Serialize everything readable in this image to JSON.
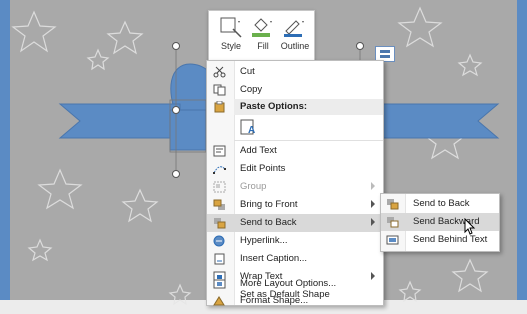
{
  "mini_toolbar": {
    "style_label": "Style",
    "fill_label": "Fill",
    "outline_label": "Outline"
  },
  "context_menu": {
    "items": [
      {
        "label": "Cut",
        "name": "cut",
        "icon": "scissors-icon",
        "submenu": false,
        "disabled": false
      },
      {
        "label": "Copy",
        "name": "copy",
        "icon": "copy-icon",
        "submenu": false,
        "disabled": false
      },
      {
        "label": "Paste Options:",
        "name": "paste-options",
        "icon": "clipboard-icon",
        "submenu": false,
        "disabled": false
      },
      {
        "label": "Add Text",
        "name": "add-text",
        "icon": "text-box-icon",
        "submenu": false,
        "disabled": false
      },
      {
        "label": "Edit Points",
        "name": "edit-points",
        "icon": "edit-points-icon",
        "submenu": false,
        "disabled": false
      },
      {
        "label": "Group",
        "name": "group",
        "icon": "group-icon",
        "submenu": true,
        "disabled": true
      },
      {
        "label": "Bring to Front",
        "name": "bring-to-front",
        "icon": "bring-to-front-icon",
        "submenu": true,
        "disabled": false
      },
      {
        "label": "Send to Back",
        "name": "send-to-back",
        "icon": "send-to-back-icon",
        "submenu": true,
        "disabled": false
      },
      {
        "label": "Hyperlink...",
        "name": "hyperlink",
        "icon": "hyperlink-icon",
        "submenu": false,
        "disabled": false
      },
      {
        "label": "Insert Caption...",
        "name": "insert-caption",
        "icon": "caption-icon",
        "submenu": false,
        "disabled": false
      },
      {
        "label": "Wrap Text",
        "name": "wrap-text",
        "icon": "wrap-text-icon",
        "submenu": true,
        "disabled": false
      },
      {
        "label": "Set as Default Shape",
        "name": "set-default-shape",
        "icon": "",
        "submenu": false,
        "disabled": false
      },
      {
        "label": "More Layout Options...",
        "name": "more-layout-options",
        "icon": "layout-options-icon",
        "submenu": false,
        "disabled": false
      },
      {
        "label": "Format Shape...",
        "name": "format-shape",
        "icon": "format-shape-icon",
        "submenu": false,
        "disabled": false
      }
    ]
  },
  "submenu": {
    "items": [
      {
        "label": "Send to Back",
        "name": "send-to-back"
      },
      {
        "label": "Send Backward",
        "name": "send-backward"
      },
      {
        "label": "Send Behind Text",
        "name": "send-behind-text"
      }
    ]
  },
  "colors": {
    "shape_blue": "#5b8bc4",
    "background_gray": "#a9a9a9",
    "highlight": "#d9d9d9"
  }
}
